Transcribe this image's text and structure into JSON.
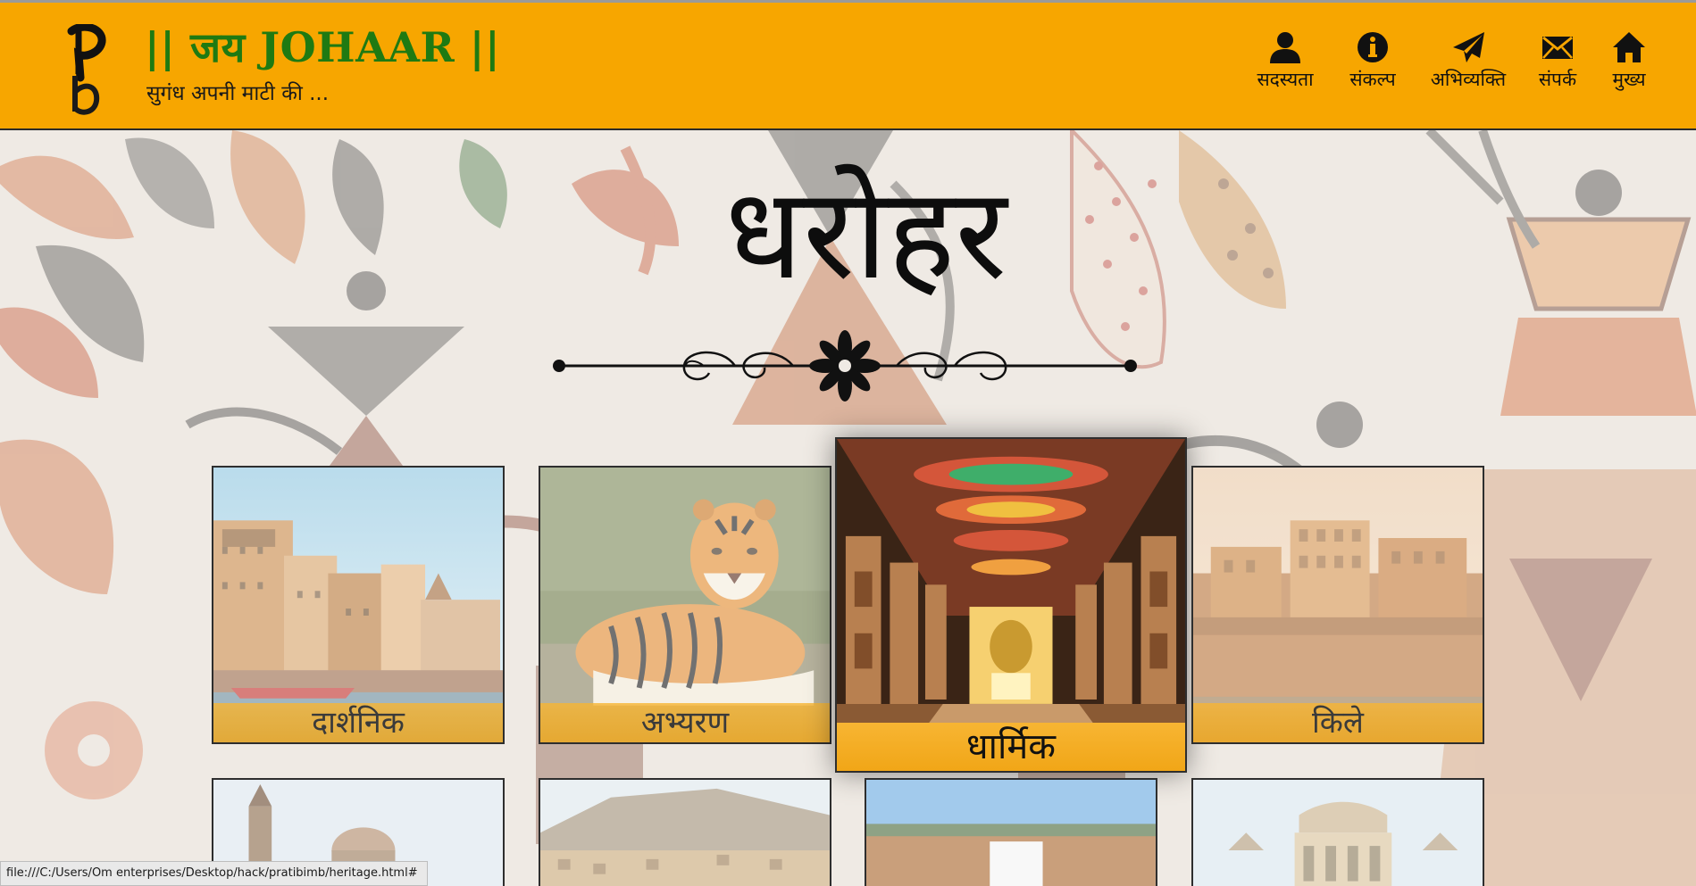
{
  "header": {
    "brand_title": "|| जय JOHAAR ||",
    "brand_tagline": "सुगंध अपनी माटी की ...",
    "logo_icon": "pb-logo-icon",
    "background_color": "#f7a600",
    "title_color": "#1f7a12"
  },
  "nav": {
    "items": [
      {
        "label": "सदस्यता",
        "icon": "user-icon"
      },
      {
        "label": "संकल्प",
        "icon": "info-icon"
      },
      {
        "label": "अभिव्यक्ति",
        "icon": "paper-plane-icon"
      },
      {
        "label": "संपर्क",
        "icon": "envelope-icon"
      },
      {
        "label": "मुख्य",
        "icon": "home-icon"
      }
    ]
  },
  "main": {
    "title": "धरोहर",
    "divider_icon": "flower-divider-icon"
  },
  "cards": [
    {
      "label": "दार्शनिक",
      "image": "varanasi-ghats-image",
      "active": false
    },
    {
      "label": "अभ्यरण",
      "image": "tiger-image",
      "active": false
    },
    {
      "label": "धार्मिक",
      "image": "temple-corridor-image",
      "active": true
    },
    {
      "label": "किले",
      "image": "fort-image",
      "active": false
    },
    {
      "label": "",
      "image": "palace-domes-image",
      "active": false
    },
    {
      "label": "",
      "image": "hill-town-image",
      "active": false
    },
    {
      "label": "",
      "image": "waterfall-image",
      "active": false
    },
    {
      "label": "",
      "image": "chhatri-pavilion-image",
      "active": false
    }
  ],
  "statusbar": {
    "url": "file:///C:/Users/Om enterprises/Desktop/hack/pratibimb/heritage.html#"
  }
}
